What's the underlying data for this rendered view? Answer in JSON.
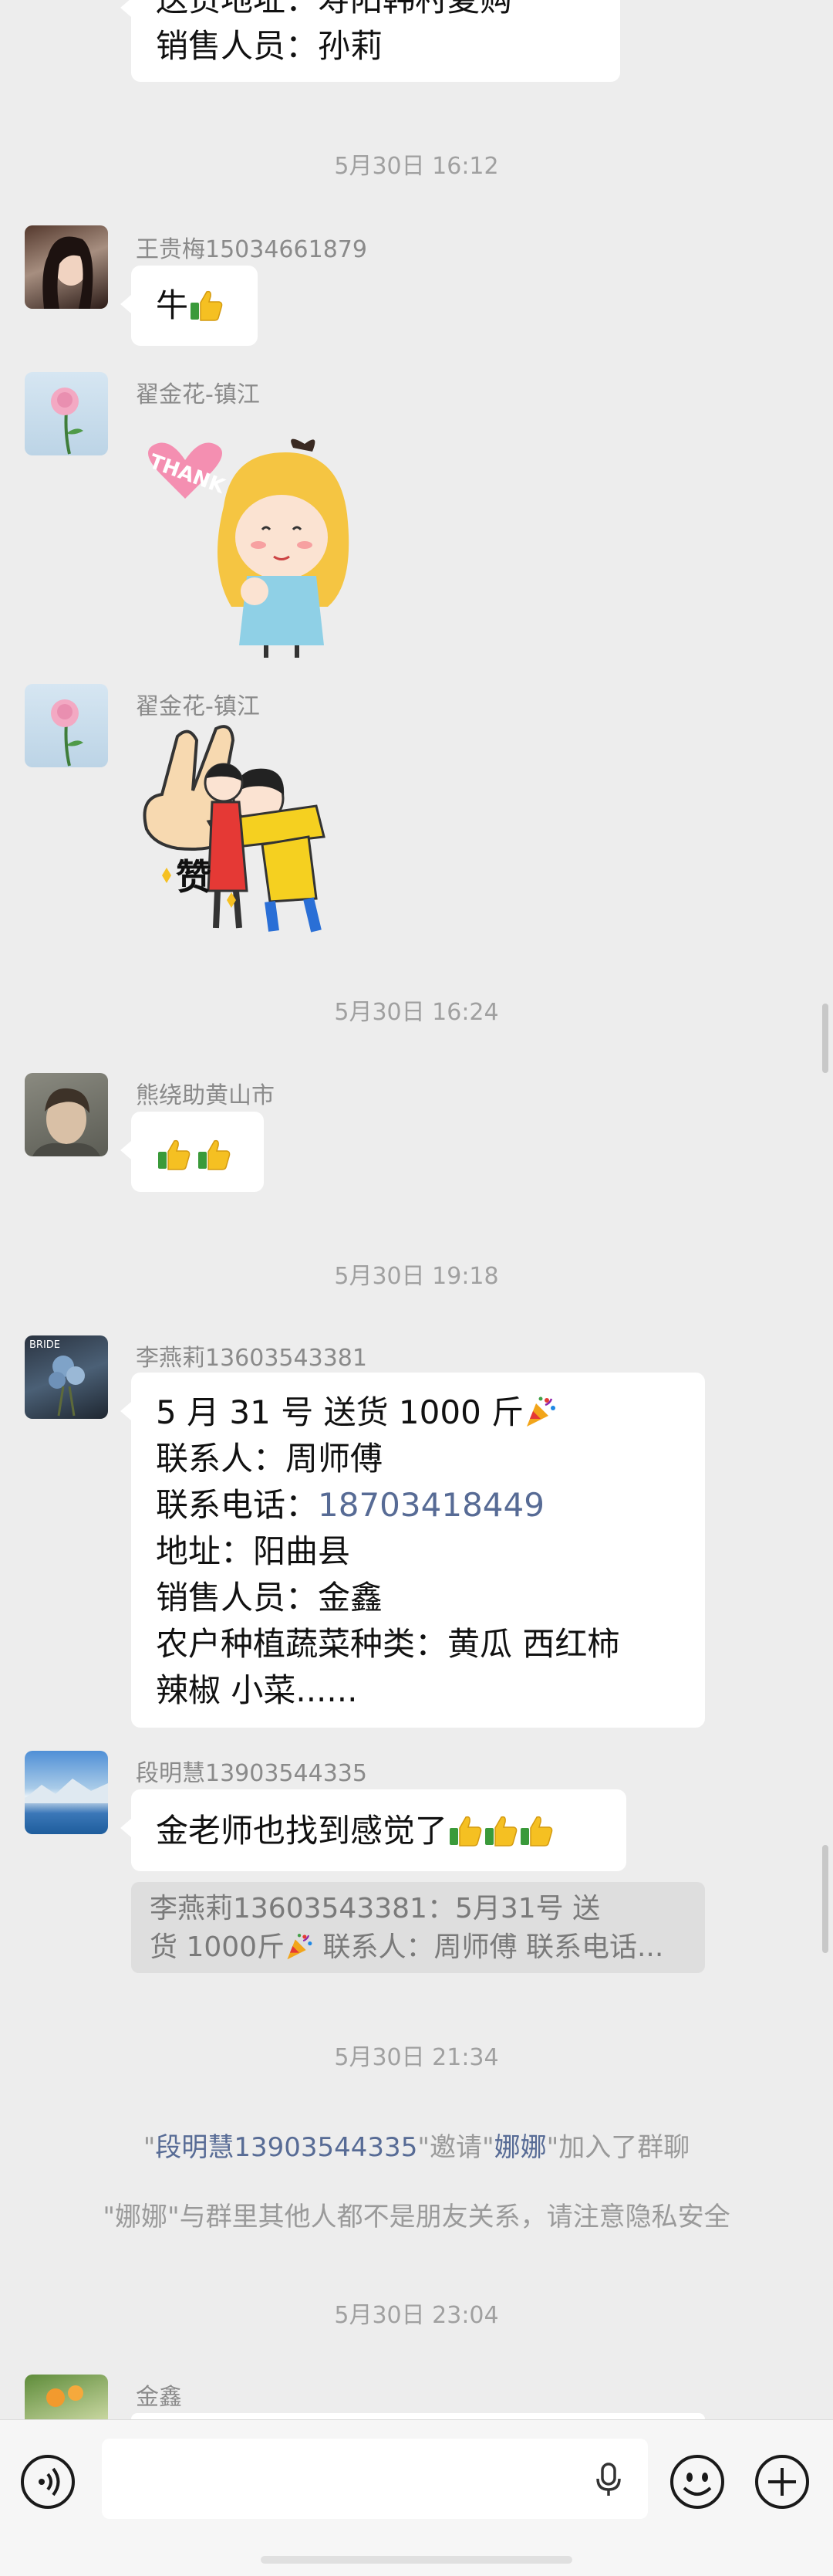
{
  "top_message": {
    "line1": "送货地址：寿阳韩村夏购",
    "line2": "销售人员：孙莉"
  },
  "timestamps": [
    "5月30日 16:12",
    "5月30日 16:24",
    "5月30日 19:18",
    "5月30日 21:34",
    "5月30日 23:04"
  ],
  "messages": {
    "m1": {
      "sender": "王贵梅15034661879",
      "text": "牛"
    },
    "m2": {
      "sender": "翟金花-镇江",
      "sticker": "THANK"
    },
    "m3": {
      "sender": "翟金花-镇江",
      "sticker": "赞"
    },
    "m4": {
      "sender": "熊绕助黄山市"
    },
    "m5": {
      "sender": "李燕莉13603543381",
      "l1": "5 月 31 号  送货  1000 斤",
      "l2": "联系人：周师傅",
      "l3a": "联系电话：",
      "l3b": "18703418449",
      "l4": "地址：阳曲县",
      "l5": "销售人员：金鑫",
      "l6": "农户种植蔬菜种类：黄瓜 西红柿",
      "l7": "辣椒 小菜......"
    },
    "m6": {
      "sender": "段明慧13903544335",
      "text": "金老师也找到感觉了",
      "quote_l1": "李燕莉13603543381：5月31号 送",
      "quote_l2a": "货  1000斤",
      "quote_l2b": " 联系人：周师傅 联系电话..."
    },
    "m7": {
      "sender": "金鑫"
    }
  },
  "system": {
    "invite_q1": "\"",
    "invite_name1": "段明慧13903544335",
    "invite_mid": "\"邀请\"",
    "invite_name2": "娜娜",
    "invite_end": "\"加入了群聊",
    "privacy": "\"娜娜\"与群里其他人都不是朋友关系，请注意隐私安全"
  },
  "input": {
    "value": ""
  },
  "colors": {
    "link": "#576b95",
    "background": "#ededed",
    "bubble": "#ffffff"
  }
}
